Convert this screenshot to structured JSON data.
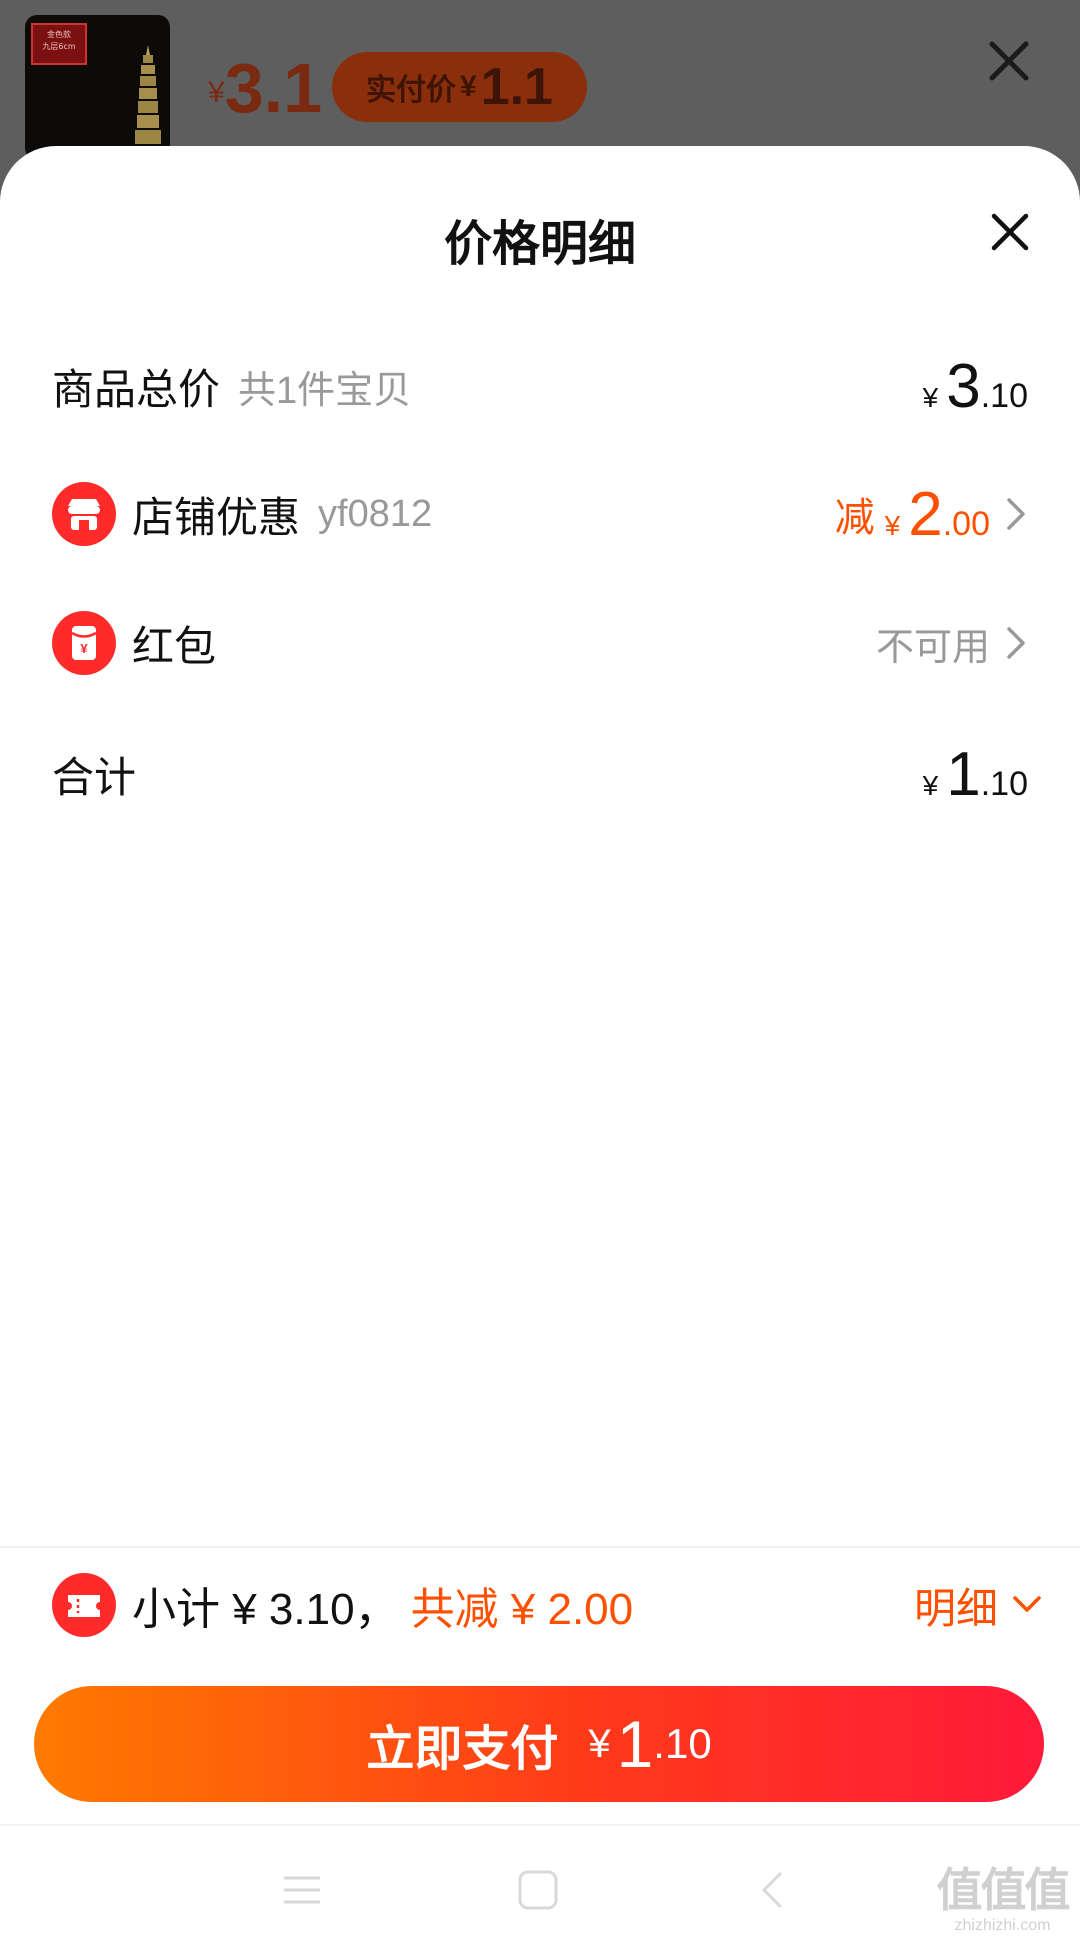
{
  "background": {
    "thumbnail": {
      "tag_line1": "金色款",
      "tag_line2": "九层6cm"
    },
    "price": {
      "symbol": "¥",
      "value": "3.1"
    },
    "pay_pill": {
      "label": "实付价",
      "symbol": "¥",
      "value": "1.1"
    }
  },
  "sheet": {
    "title": "价格明细",
    "rows": {
      "total": {
        "label": "商品总价",
        "sub": "共1件宝贝",
        "symbol": "¥",
        "int": "3",
        "dec": ".10"
      },
      "shop": {
        "label": "店铺优惠",
        "sub": "yf0812",
        "prefix": "减",
        "symbol": "¥",
        "int": "2",
        "dec": ".00",
        "icon": "shop-icon"
      },
      "redpacket": {
        "label": "红包",
        "status": "不可用",
        "icon": "red-packet-icon"
      },
      "sum": {
        "label": "合计",
        "symbol": "¥",
        "int": "1",
        "dec": ".10"
      }
    }
  },
  "bottom": {
    "summary": "小计 ¥ 3.10，",
    "discount": "共减 ¥ 2.00",
    "detail_label": "明细",
    "pay_button": {
      "label": "立即支付",
      "symbol": "¥",
      "int": "1",
      "dec": ".10"
    }
  },
  "watermark": {
    "big": "值值值",
    "small": "zhizhizhi.com"
  },
  "colors": {
    "accent": "#ff5000",
    "red": "#ff2a2a",
    "pay_start": "#ff7a00",
    "pay_end": "#ff1a3a"
  }
}
